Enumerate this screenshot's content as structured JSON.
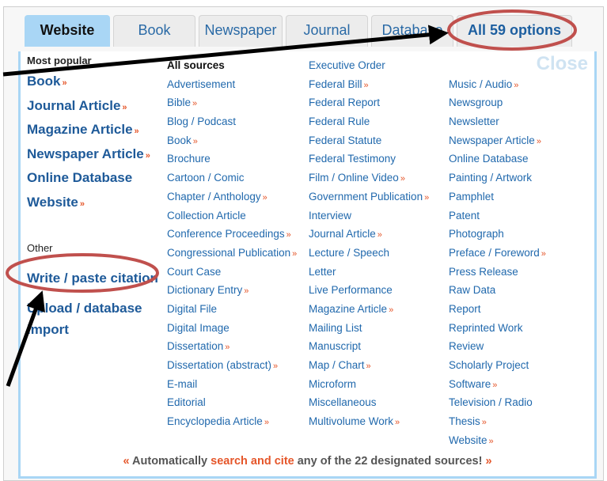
{
  "tabs": [
    {
      "label": "Website",
      "active": true
    },
    {
      "label": "Book"
    },
    {
      "label": "Newspaper"
    },
    {
      "label": "Journal"
    },
    {
      "label": "Database"
    },
    {
      "label": "All 59 options"
    }
  ],
  "close_label": "Close",
  "most_popular": {
    "heading": "Most popular",
    "items": [
      {
        "label": "Book",
        "arrow": "»"
      },
      {
        "label": "Journal Article",
        "arrow": "»"
      },
      {
        "label": "Magazine Article",
        "arrow": "»"
      },
      {
        "label": "Newspaper Article",
        "arrow": "»"
      },
      {
        "label": "Online Database"
      },
      {
        "label": "Website",
        "arrow": "»"
      }
    ]
  },
  "other": {
    "heading": "Other",
    "items": [
      {
        "label": "Write / paste citation"
      },
      {
        "label": "Upload / database import"
      }
    ]
  },
  "columns": [
    {
      "heading": "All sources",
      "items": [
        {
          "label": "Advertisement"
        },
        {
          "label": "Bible",
          "arrow": "»"
        },
        {
          "label": "Blog / Podcast"
        },
        {
          "label": "Book",
          "arrow": "»"
        },
        {
          "label": "Brochure"
        },
        {
          "label": "Cartoon / Comic"
        },
        {
          "label": "Chapter / Anthology",
          "arrow": "»"
        },
        {
          "label": "Collection Article"
        },
        {
          "label": "Conference Proceedings",
          "arrow": "»"
        },
        {
          "label": "Congressional Publication",
          "arrow": "»"
        },
        {
          "label": "Court Case"
        },
        {
          "label": "Dictionary Entry",
          "arrow": "»"
        },
        {
          "label": "Digital File"
        },
        {
          "label": "Digital Image"
        },
        {
          "label": "Dissertation",
          "arrow": "»"
        },
        {
          "label": "Dissertation (abstract)",
          "arrow": "»"
        },
        {
          "label": "E-mail"
        },
        {
          "label": "Editorial"
        },
        {
          "label": "Encyclopedia Article",
          "arrow": "»"
        }
      ]
    },
    {
      "items": [
        {
          "label": "Executive Order"
        },
        {
          "label": "Federal Bill",
          "arrow": "»"
        },
        {
          "label": "Federal Report"
        },
        {
          "label": "Federal Rule"
        },
        {
          "label": "Federal Statute"
        },
        {
          "label": "Federal Testimony"
        },
        {
          "label": "Film / Online Video",
          "arrow": "»"
        },
        {
          "label": "Government Publication",
          "arrow": "»"
        },
        {
          "label": "Interview"
        },
        {
          "label": "Journal Article",
          "arrow": "»"
        },
        {
          "label": "Lecture / Speech"
        },
        {
          "label": "Letter"
        },
        {
          "label": "Live Performance"
        },
        {
          "label": "Magazine Article",
          "arrow": "»"
        },
        {
          "label": "Mailing List"
        },
        {
          "label": "Manuscript"
        },
        {
          "label": "Map / Chart",
          "arrow": "»"
        },
        {
          "label": "Microform"
        },
        {
          "label": "Miscellaneous"
        },
        {
          "label": "Multivolume Work",
          "arrow": "»"
        }
      ]
    },
    {
      "items": [
        {
          "label": "Music / Audio",
          "arrow": "»"
        },
        {
          "label": "Newsgroup"
        },
        {
          "label": "Newsletter"
        },
        {
          "label": "Newspaper Article",
          "arrow": "»"
        },
        {
          "label": "Online Database"
        },
        {
          "label": "Painting / Artwork"
        },
        {
          "label": "Pamphlet"
        },
        {
          "label": "Patent"
        },
        {
          "label": "Photograph"
        },
        {
          "label": "Preface / Foreword",
          "arrow": "»"
        },
        {
          "label": "Press Release"
        },
        {
          "label": "Raw Data"
        },
        {
          "label": "Report"
        },
        {
          "label": "Reprinted Work"
        },
        {
          "label": "Review"
        },
        {
          "label": "Scholarly Project"
        },
        {
          "label": "Software",
          "arrow": "»"
        },
        {
          "label": "Television / Radio"
        },
        {
          "label": "Thesis",
          "arrow": "»"
        },
        {
          "label": "Website",
          "arrow": "»"
        }
      ]
    }
  ],
  "footer": {
    "open_quote": "«",
    "prefix": "Automatically ",
    "highlight": "search and cite",
    "suffix": " any of the 22 designated sources!",
    "close_quote": "»"
  },
  "annotation_color": "#c0504d"
}
